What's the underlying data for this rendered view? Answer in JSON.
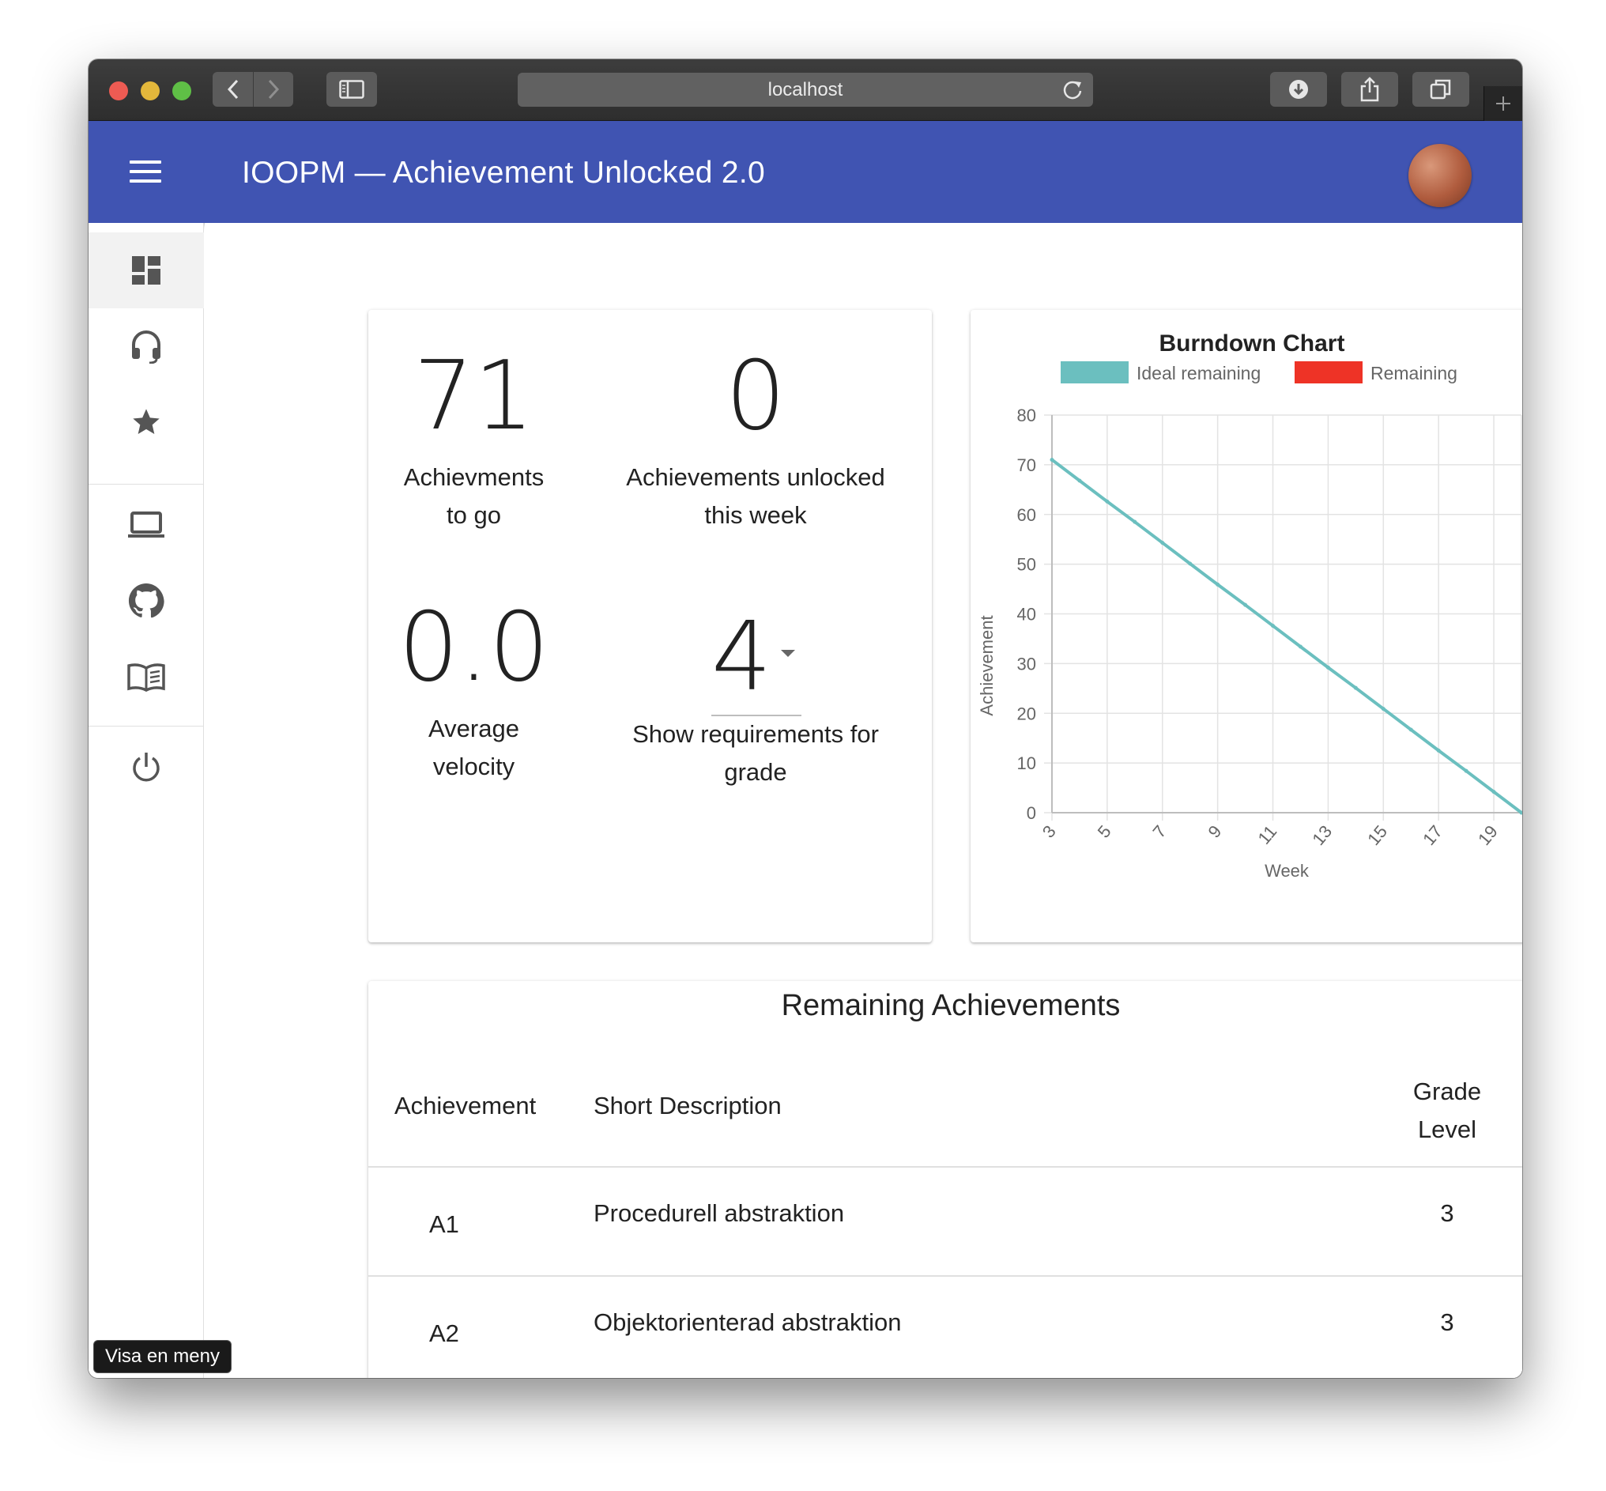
{
  "browser": {
    "url": "localhost"
  },
  "appbar": {
    "title": "IOOPM — Achievement Unlocked 2.0"
  },
  "nav": {
    "items": [
      {
        "icon": "dashboard-icon",
        "active": true
      },
      {
        "icon": "headset-icon"
      },
      {
        "icon": "star-icon"
      },
      {
        "icon": "laptop-icon"
      },
      {
        "icon": "github-icon"
      },
      {
        "icon": "book-icon"
      },
      {
        "icon": "power-icon"
      }
    ],
    "tooltip": "Visa en meny"
  },
  "stats": {
    "to_go": {
      "value": "71",
      "label_line1": "Achievments",
      "label_line2": "to go"
    },
    "unlocked": {
      "value": "0",
      "label_line1": "Achievements unlocked",
      "label_line2": "this week"
    },
    "velocity": {
      "value": "0.0",
      "label_line1": "Average",
      "label_line2": "velocity"
    },
    "grade": {
      "value": "4",
      "label_line1": "Show requirements for",
      "label_line2": "grade"
    }
  },
  "chart_data": {
    "type": "line",
    "title": "Burndown Chart",
    "xlabel": "Week",
    "ylabel": "Achievement",
    "x": [
      3,
      4,
      5,
      6,
      7,
      8,
      9,
      10,
      11,
      12,
      13,
      14,
      15,
      16,
      17,
      18,
      19,
      20
    ],
    "x_tick_labels": [
      "3",
      "5",
      "7",
      "9",
      "11",
      "13",
      "15",
      "17",
      "19"
    ],
    "ylim": [
      0,
      80
    ],
    "y_ticks": [
      0,
      10,
      20,
      30,
      40,
      50,
      60,
      70,
      80
    ],
    "grid": true,
    "legend_position": "top",
    "series": [
      {
        "name": "Ideal remaining",
        "color": "#6bbfbf",
        "values": [
          71,
          66.8,
          62.6,
          58.5,
          54.3,
          50.1,
          45.9,
          41.8,
          37.6,
          33.4,
          29.2,
          25.1,
          20.9,
          16.7,
          12.5,
          8.4,
          4.2,
          0
        ]
      },
      {
        "name": "Remaining",
        "color": "#ee3326",
        "values": []
      }
    ]
  },
  "table": {
    "title": "Remaining Achievements",
    "headers": {
      "achievement": "Achievement",
      "description": "Short Description",
      "grade_line1": "Grade",
      "grade_line2": "Level"
    },
    "rows": [
      {
        "id": "A1",
        "description": "Procedurell abstraktion",
        "grade": "3"
      },
      {
        "id": "A2",
        "description": "Objektorienterad abstraktion",
        "grade": "3"
      }
    ]
  },
  "colors": {
    "appbar": "#4054b2",
    "ideal_line": "#6bbfbf",
    "remaining": "#ee3326"
  }
}
